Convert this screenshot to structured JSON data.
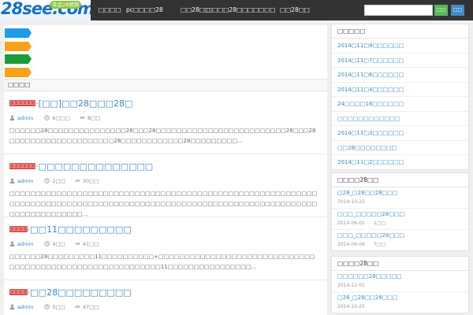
{
  "logo": {
    "text": "28see.com",
    "badge": "幸运28预测"
  },
  "nav": [
    "□□□□",
    "pc□□□□28",
    "□□28□□",
    "□□□□28□□",
    "□□□□□",
    "□□28□□"
  ],
  "search": {
    "placeholder": "",
    "search_label": "□□",
    "login_label": "□□"
  },
  "flags": {
    "colors": [
      "#1e9be9",
      "#f7a21b",
      "#1d9a3a",
      "#f7a21b"
    ]
  },
  "section_title": "□□□□",
  "posts": [
    {
      "badge": "□□□□□□",
      "title": "·[□□]□□28□□□28□",
      "author": "admin",
      "time": "6□□□",
      "views": "8□□",
      "excerpt": "□□□□□□28□□□□□□□□□□□□□□□28□□□28□□□□□□□□□□□□□□□□□□□□□□□□□28□□□28□□□□□□□□□□□□□□□□□□□□28□□□□□□□□□□□□28□□□□□□□□□…"
    },
    {
      "badge": "□□□□□□",
      "title": "·□□□□□□□□□□□□□□",
      "author": "admin",
      "time": "2□□",
      "views": "30□□",
      "excerpt": "□□□□□□□□□□□□□□□□□□□□□□□□□□□□□□□□□□□□□□□□□□□□□□□□□□□□□□□□□□□□□□□□□□□□□□□□□□□□□□□□□□□□□□□□□□□□□□□□□□□□□□□□□□□□□□□□□□□□□□□□□□□□□□□□□□□□…"
    },
    {
      "badge": "□□□□",
      "title": "·□□11□□□□□□□□□",
      "author": "admin",
      "time": "4□□",
      "views": "41□□",
      "excerpt": "□□□□□□28□□□□□□□□□11□□□□□□□□□□+□□□□□□□□□□□□□□□□□□□□□□□□□□□□□□ □□□□□□□□□□□□□□□□□□□□□□□□□□□□□11□□□□□□□□□□□□□□□□…"
    },
    {
      "badge": "□□□□",
      "title": "·□□28□□□□□□□□□",
      "author": "admin",
      "time": "5□□",
      "views": "47□□"
    }
  ],
  "sidebar": {
    "recent": {
      "title": "□□□□□",
      "items": [
        "2014□11□9□□□□□□",
        "2014□11□7□□□□□□",
        "2014□11□6□□□□□□",
        "2014□11□4□□□□□□",
        "24□□□□16□□□□□□",
        "□□□□□□□□□□□□",
        "2014□11□3□□□□□□",
        "□□28□□□□□□□□",
        "2014□11□2□□□□□□"
      ]
    },
    "popular": {
      "title": "□□□□28□□",
      "items": [
        {
          "title": "□28_□28□□28□□□",
          "date": "2014-10-25",
          "count": ""
        },
        {
          "title": "□□□_□□□□□28□□□",
          "date": "2014-06-01",
          "count": "1□□"
        },
        {
          "title": "□□□_□□□□□28□□□",
          "date": "2014-06-06",
          "count": "7□□"
        }
      ]
    },
    "latest": {
      "title": "□□□□28□□",
      "items": [
        {
          "title": "□□□□□□28□□□□□",
          "date": "2014-11-01"
        },
        {
          "title": "□28_□28□□28□□□",
          "date": "2014-10-25"
        }
      ]
    }
  }
}
